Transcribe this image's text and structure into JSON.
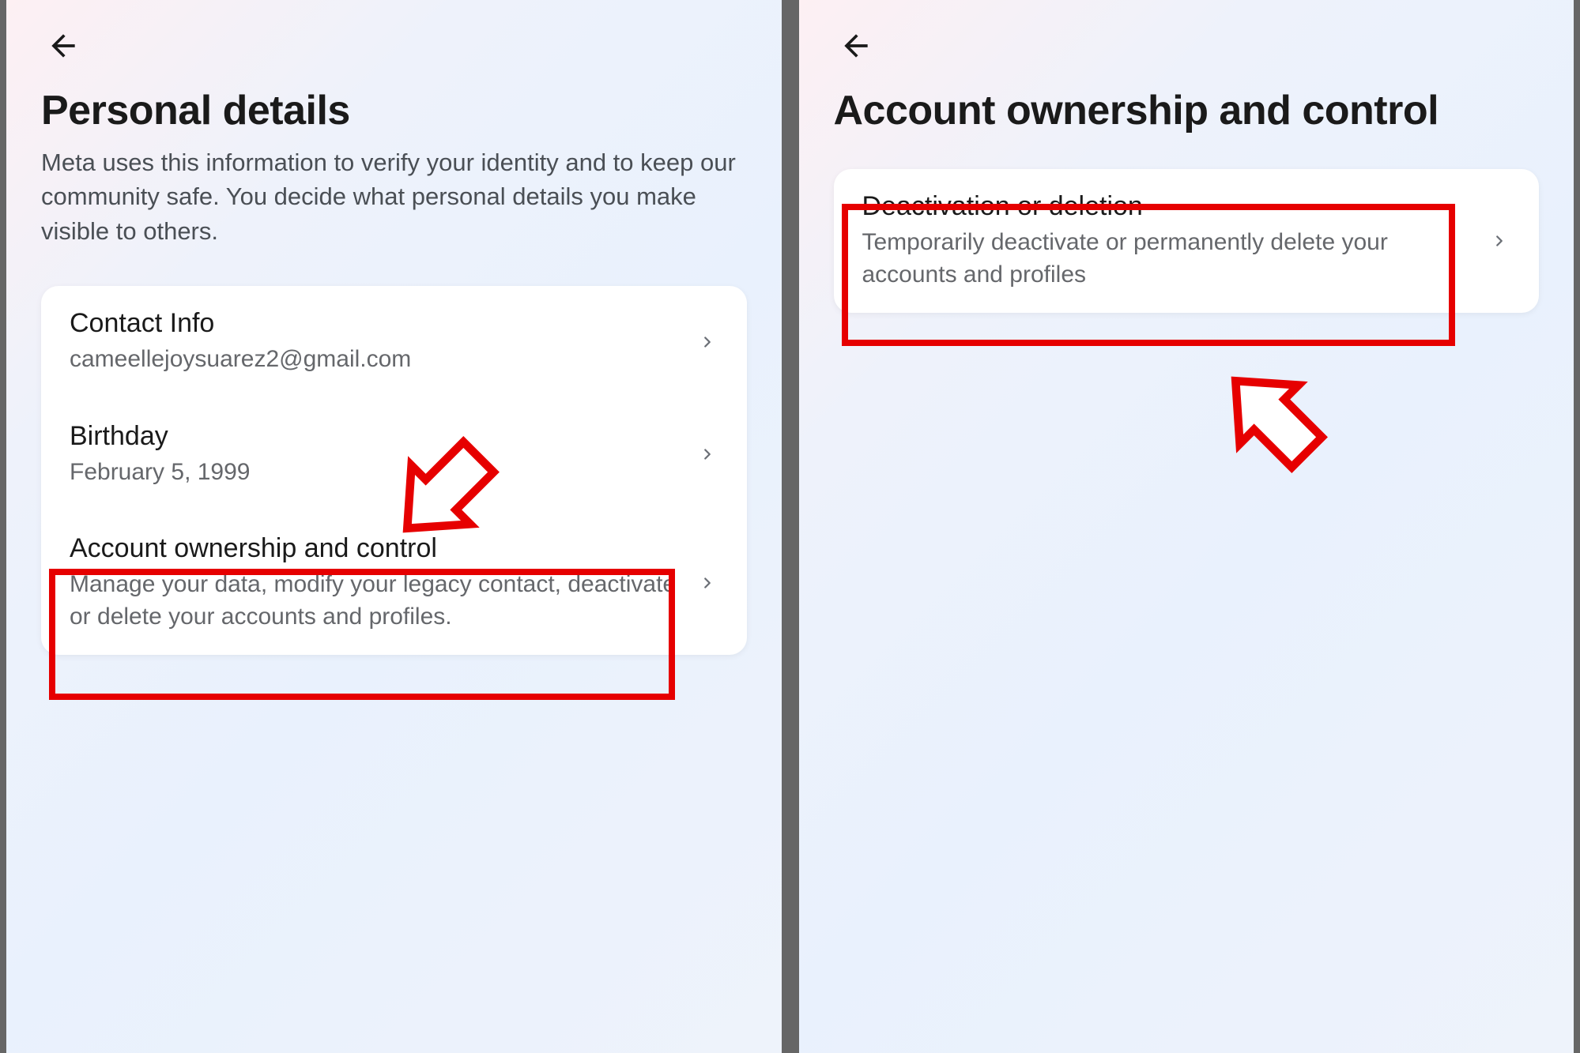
{
  "left": {
    "title": "Personal details",
    "description": "Meta uses this information to verify your identity and to keep our community safe. You decide what personal details you make visible to others.",
    "rows": {
      "contact": {
        "title": "Contact Info",
        "sub": "cameellejoysuarez2@gmail.com"
      },
      "birthday": {
        "title": "Birthday",
        "sub": "February 5, 1999"
      },
      "account": {
        "title": "Account ownership and control",
        "sub": "Manage your data, modify your legacy contact, deactivate or delete your accounts and profiles."
      }
    }
  },
  "right": {
    "title": "Account ownership and control",
    "rows": {
      "deactivate": {
        "title": "Deactivation or deletion",
        "sub": "Temporarily deactivate or permanently delete your accounts and profiles"
      }
    }
  },
  "annotation_color": "#e60000"
}
